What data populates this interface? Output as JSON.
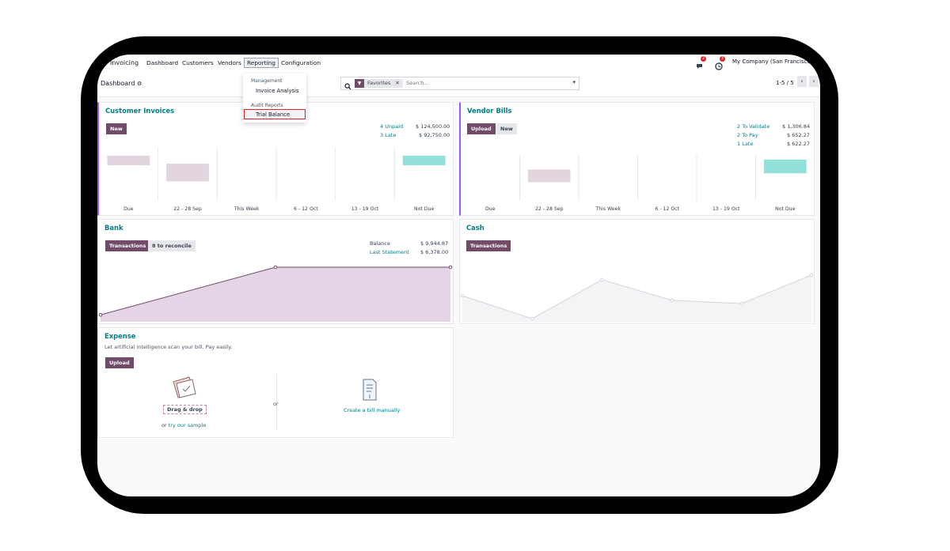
{
  "nav": {
    "app": "Invoicing",
    "items": [
      "Dashboard",
      "Customers",
      "Vendors",
      "Reporting",
      "Configuration"
    ]
  },
  "topbar": {
    "chat_badge": "2",
    "activity_badge": "3",
    "company": "My Company (San Francisco)"
  },
  "breadcrumb": "Dashboard",
  "search": {
    "facet": "Favorites",
    "placeholder": "Search..."
  },
  "pager": {
    "text": "1-5 / 5"
  },
  "reporting_menu": {
    "section1": "Management",
    "item1": "Invoice Analysis",
    "section2": "Audit Reports",
    "item2": "Trial Balance"
  },
  "customer_invoices": {
    "title": "Customer Invoices",
    "new_btn": "New",
    "stats": [
      {
        "label": "4 Unpaid",
        "amount": "$ 124,500.00"
      },
      {
        "label": "3 Late",
        "amount": "$ 92,750.00"
      }
    ],
    "chart_data": {
      "type": "bar",
      "categories": [
        "Due",
        "22 - 28 Sep",
        "This Week",
        "6 - 12 Oct",
        "13 - 19 Oct",
        "Not Due"
      ],
      "values": [
        0.3,
        -0.6,
        0,
        0,
        0,
        0.3
      ],
      "colors": [
        "#e2d5df",
        "#e2d5df",
        "#e2d5df",
        "#e2d5df",
        "#e2d5df",
        "#92e0da"
      ]
    }
  },
  "vendor_bills": {
    "title": "Vendor Bills",
    "upload_btn": "Upload",
    "new_btn": "New",
    "stats": [
      {
        "label": "2 To Validate",
        "amount": "$ 1,306.84"
      },
      {
        "label": "2 To Pay",
        "amount": "$ 652.27"
      },
      {
        "label": "1 Late",
        "amount": "$ 622.27"
      }
    ],
    "chart_data": {
      "type": "bar",
      "categories": [
        "Due",
        "22 - 28 Sep",
        "This Week",
        "6 - 12 Oct",
        "13 - 19 Oct",
        "Not Due"
      ],
      "values": [
        0,
        -0.5,
        0,
        0,
        0,
        0.5
      ],
      "colors": [
        "#e2d5df",
        "#e2d5df",
        "#e2d5df",
        "#e2d5df",
        "#e2d5df",
        "#92e0da"
      ]
    }
  },
  "bank": {
    "title": "Bank",
    "transactions_btn": "Transactions",
    "reconcile_btn": "8 to reconcile",
    "balance_label": "Balance",
    "balance_value": "$ 9,944.87",
    "last_statement_label": "Last Statement",
    "last_statement_value": "$ 6,378.00",
    "chart_data": {
      "type": "area",
      "x": [
        0,
        1,
        2
      ],
      "values": [
        0.1,
        1.0,
        1.0
      ],
      "color": "#714b67",
      "fill": "#e4d4e6"
    }
  },
  "cash": {
    "title": "Cash",
    "transactions_btn": "Transactions",
    "chart_data": {
      "type": "area",
      "x": [
        0,
        1,
        2,
        3,
        4,
        5
      ],
      "values": [
        0.55,
        0.05,
        0.9,
        0.45,
        0.38,
        1.0
      ],
      "color": "#d1d5db",
      "fill": "#f3f4f6"
    }
  },
  "expense": {
    "title": "Expense",
    "description": "Let artificial intelligence scan your bill. Pay easily.",
    "upload_btn": "Upload",
    "drag_drop": "Drag & drop",
    "or_label": "or",
    "try_sample": "try our sample",
    "or_center": "or",
    "manual": "Create a bill manually"
  }
}
